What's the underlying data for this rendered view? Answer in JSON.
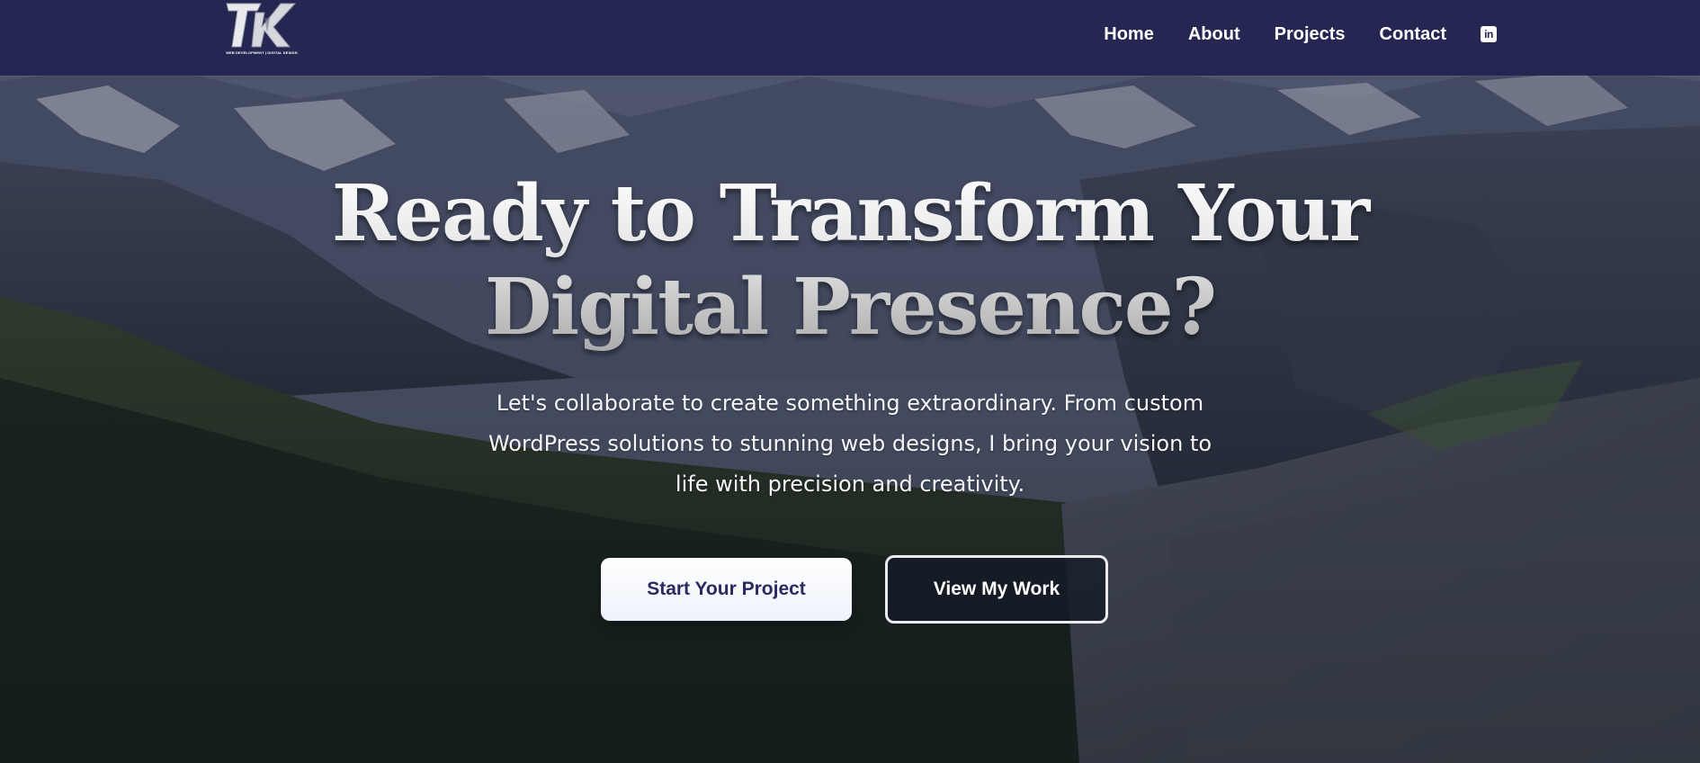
{
  "nav": {
    "logo_letters": "TK",
    "logo_tagline": "WEB DEVELOPMENT | DIGITAL DESIGN",
    "links": [
      {
        "label": "Home"
      },
      {
        "label": "About"
      },
      {
        "label": "Projects"
      },
      {
        "label": "Contact"
      }
    ],
    "linkedin_icon": "linkedin-icon",
    "linkedin_glyph": "in"
  },
  "hero": {
    "title_line1": "Ready to Transform Your",
    "title_line2": "Digital Presence?",
    "subtitle": "Let's collaborate to create something extraordinary. From custom WordPress solutions to stunning web designs, I bring your vision to life with precision and creativity.",
    "primary_button": "Start Your Project",
    "secondary_button": "View My Work"
  },
  "colors": {
    "nav_bg": "#222250",
    "primary_button_text": "#2a2a63",
    "title_text": "#dcdcdc"
  }
}
